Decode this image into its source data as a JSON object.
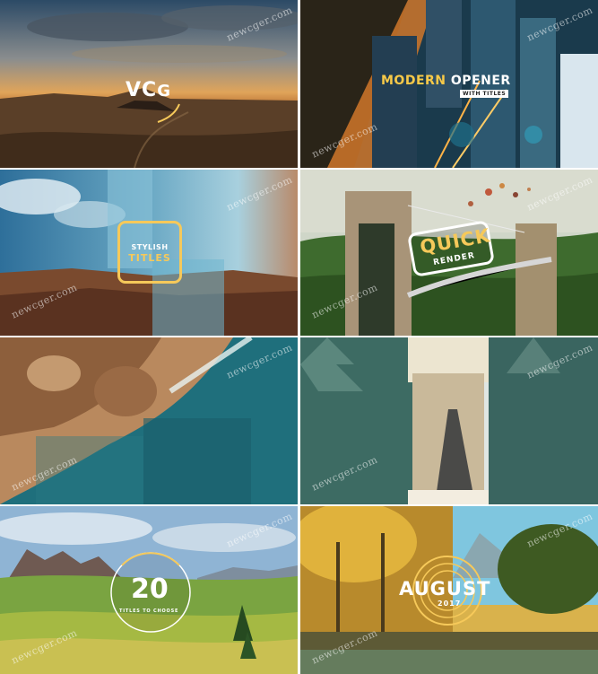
{
  "watermark": "newcger.com",
  "tiles": {
    "t1": {
      "title_v": "V",
      "title_c": "C",
      "title_g": "G"
    },
    "t2": {
      "title_part1": "MODERN ",
      "title_part2": "OPENER",
      "subtitle": "WITH TITLES"
    },
    "t3": {
      "line1": "STYLISH",
      "line2": "TITLES"
    },
    "t4": {
      "line1": "QUICK",
      "line2": "RENDER"
    },
    "t7": {
      "number": "20",
      "caption": "TITLES TO CHOOSE"
    },
    "t8": {
      "month": "AUGUST",
      "year": "2017"
    }
  },
  "colors": {
    "accent": "#f6c95a",
    "text": "#ffffff"
  }
}
